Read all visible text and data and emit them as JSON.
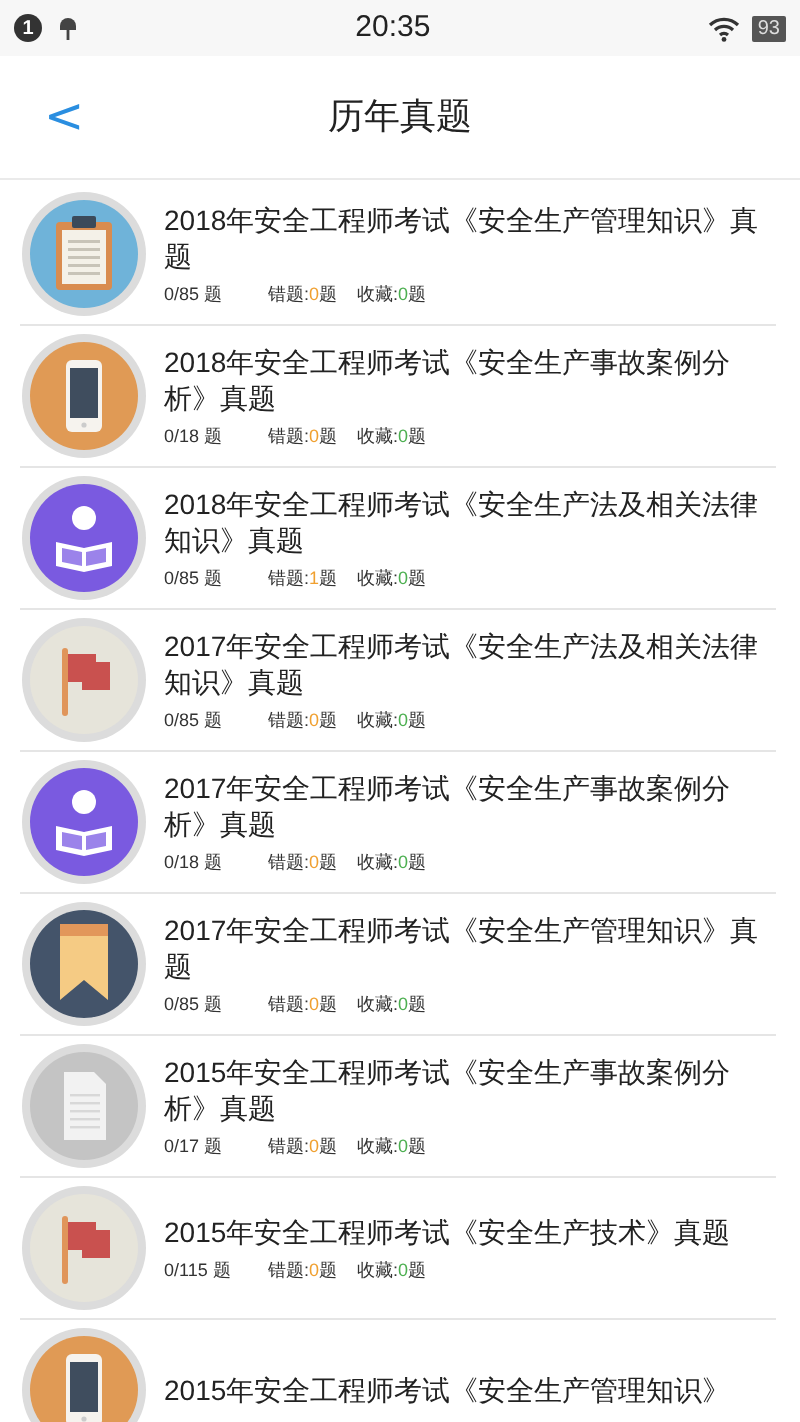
{
  "status_bar": {
    "notification_count": "1",
    "time": "20:35",
    "battery": "93"
  },
  "header": {
    "back": "<",
    "title": "历年真题"
  },
  "items": [
    {
      "kind": "clipboard",
      "title": "2018年安全工程师考试《安全生产管理知识》真题",
      "progress": "0/85 题",
      "wrong_label": "错题:",
      "wrong": "0",
      "wrong_unit": "题",
      "fav_label": "收藏:",
      "fav": "0",
      "fav_unit": "题"
    },
    {
      "kind": "phone",
      "title": "2018年安全工程师考试《安全生产事故案例分析》真题",
      "progress": "0/18 题",
      "wrong_label": "错题:",
      "wrong": "0",
      "wrong_unit": "题",
      "fav_label": "收藏:",
      "fav": "0",
      "fav_unit": "题"
    },
    {
      "kind": "reader",
      "title": "2018年安全工程师考试《安全生产法及相关法律知识》真题",
      "progress": "0/85 题",
      "wrong_label": "错题:",
      "wrong": "1",
      "wrong_unit": "题",
      "fav_label": "收藏:",
      "fav": "0",
      "fav_unit": "题"
    },
    {
      "kind": "flag",
      "title": "2017年安全工程师考试《安全生产法及相关法律知识》真题",
      "progress": "0/85 题",
      "wrong_label": "错题:",
      "wrong": "0",
      "wrong_unit": "题",
      "fav_label": "收藏:",
      "fav": "0",
      "fav_unit": "题"
    },
    {
      "kind": "reader",
      "title": "2017年安全工程师考试《安全生产事故案例分析》真题",
      "progress": "0/18 题",
      "wrong_label": "错题:",
      "wrong": "0",
      "wrong_unit": "题",
      "fav_label": "收藏:",
      "fav": "0",
      "fav_unit": "题"
    },
    {
      "kind": "bookmark",
      "title": "2017年安全工程师考试《安全生产管理知识》真题",
      "progress": "0/85 题",
      "wrong_label": "错题:",
      "wrong": "0",
      "wrong_unit": "题",
      "fav_label": "收藏:",
      "fav": "0",
      "fav_unit": "题"
    },
    {
      "kind": "document",
      "title": "2015年安全工程师考试《安全生产事故案例分析》真题",
      "progress": "0/17 题",
      "wrong_label": "错题:",
      "wrong": "0",
      "wrong_unit": "题",
      "fav_label": "收藏:",
      "fav": "0",
      "fav_unit": "题"
    },
    {
      "kind": "flag",
      "title": "2015年安全工程师考试《安全生产技术》真题",
      "progress": "0/115 题",
      "wrong_label": "错题:",
      "wrong": "0",
      "wrong_unit": "题",
      "fav_label": "收藏:",
      "fav": "0",
      "fav_unit": "题"
    },
    {
      "kind": "phone",
      "title": "2015年安全工程师考试《安全生产管理知识》"
    }
  ]
}
